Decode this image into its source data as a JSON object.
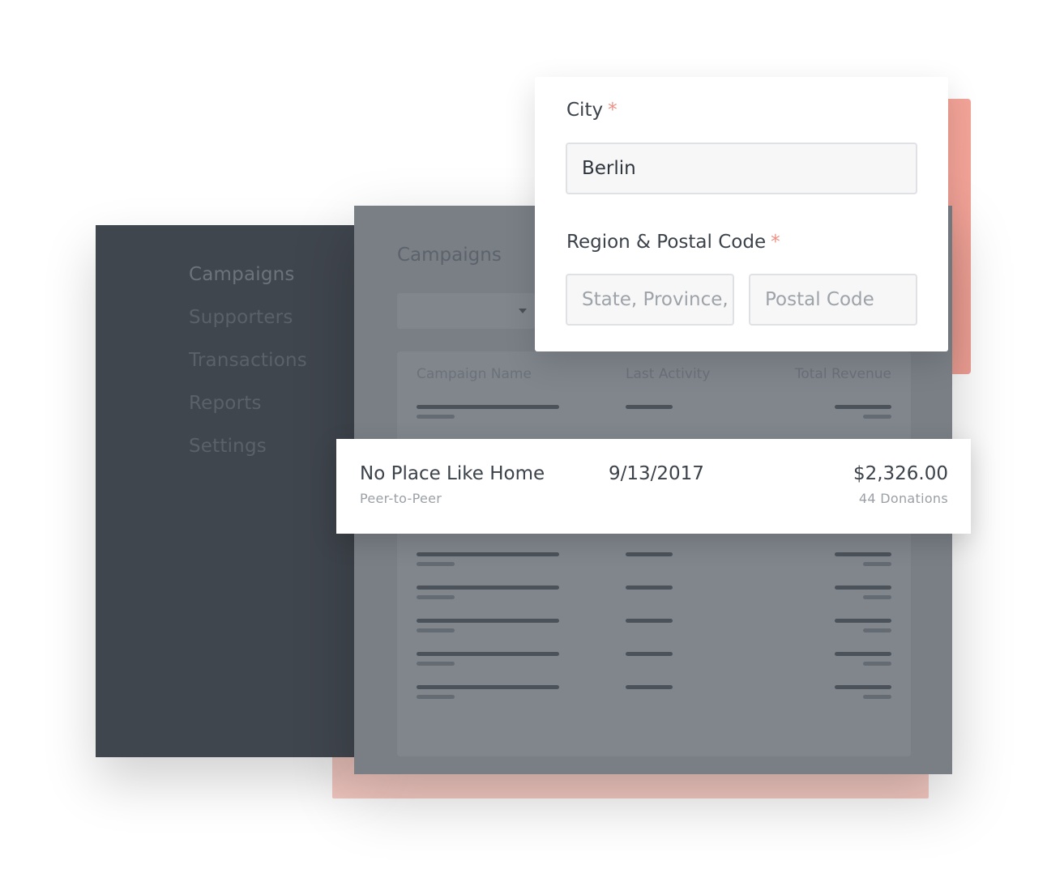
{
  "form": {
    "city_label": "City",
    "city_required_marker": "*",
    "city_value": "Berlin",
    "region_label": "Region & Postal Code",
    "region_required_marker": "*",
    "state_placeholder": "State, Province,",
    "postal_placeholder": "Postal Code"
  },
  "sidebar": {
    "items": [
      {
        "label": "Campaigns",
        "active": true
      },
      {
        "label": "Supporters",
        "active": false
      },
      {
        "label": "Transactions",
        "active": false
      },
      {
        "label": "Reports",
        "active": false
      },
      {
        "label": "Settings",
        "active": false
      }
    ]
  },
  "main": {
    "title": "Campaigns",
    "table": {
      "columns": [
        "Campaign Name",
        "Last Activity",
        "Total Revenue"
      ]
    }
  },
  "highlight_row": {
    "name": "No Place Like Home",
    "type": "Peer-to-Peer",
    "date": "9/13/2017",
    "amount": "$2,326.00",
    "donations": "44 Donations"
  },
  "colors": {
    "accent_salmon": "#f3a397",
    "sidebar_bg": "#40464e",
    "panel_bg": "#7a7f86",
    "required_marker": "#ee8f82"
  }
}
